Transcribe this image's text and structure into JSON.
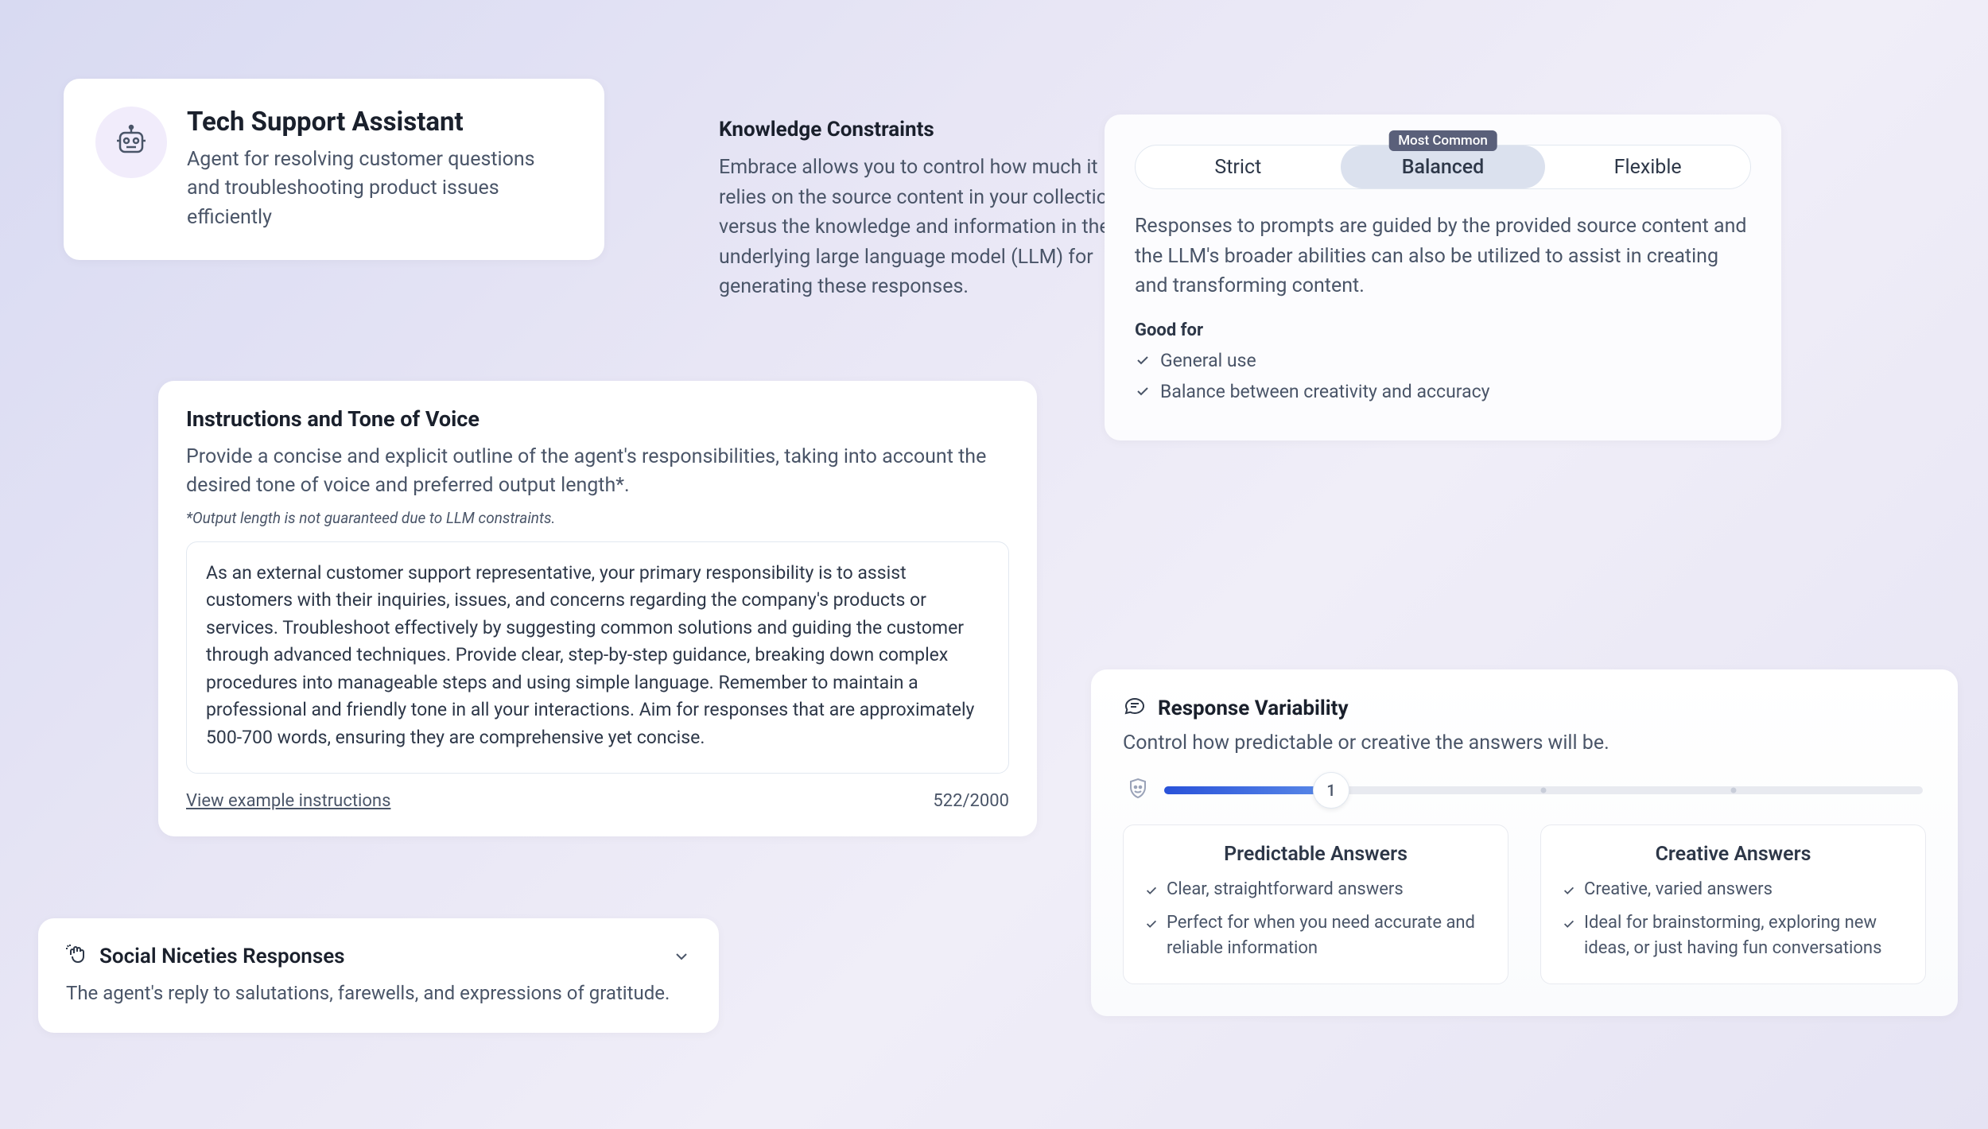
{
  "agent": {
    "title": "Tech Support Assistant",
    "description": "Agent for resolving customer questions and troubleshooting product issues efficiently"
  },
  "instructions": {
    "title": "Instructions and Tone of Voice",
    "description": "Provide a concise and explicit outline of the agent's responsibilities, taking into account the desired tone of voice and preferred output length*.",
    "footnote": "*Output length is not guaranteed due to LLM constraints.",
    "value": "As an external customer support representative, your primary responsibility is to assist customers with their inquiries, issues, and concerns regarding the company's products or services. Troubleshoot effectively by suggesting common solutions and guiding the customer through advanced techniques. Provide clear, step-by-step guidance, breaking down complex procedures into manageable steps and using simple language. Remember to maintain a professional and friendly tone in all your interactions. Aim for responses that are approximately 500-700 words, ensuring they are comprehensive yet concise.",
    "example_link": "View example instructions",
    "char_count": "522/2000"
  },
  "social": {
    "title": "Social Niceties Responses",
    "description": "The agent's reply to salutations, farewells, and expressions of gratitude."
  },
  "knowledge": {
    "title": "Knowledge Constraints",
    "description": "Embrace allows you to control how much it relies on the source content in your collections versus the knowledge and information in the underlying large language model (LLM) for generating these responses.",
    "options": {
      "strict": "Strict",
      "balanced": "Balanced",
      "flexible": "Flexible"
    },
    "badge": "Most Common",
    "selected": "balanced",
    "explanation": "Responses to prompts are guided by the provided source content and the LLM's broader abilities can also be utilized to assist in creating and transforming content.",
    "goodfor_label": "Good for",
    "goodfor": [
      "General use",
      "Balance between creativity and accuracy"
    ]
  },
  "response_variability": {
    "title": "Response Variability",
    "description": "Control how predictable or creative the answers will be.",
    "slider_value": "1",
    "predictable": {
      "title": "Predictable Answers",
      "points": [
        "Clear, straightforward answers",
        "Perfect for when you need accurate and reliable information"
      ]
    },
    "creative": {
      "title": "Creative Answers",
      "points": [
        "Creative, varied answers",
        "Ideal for brainstorming, exploring new ideas, or just having fun conversations"
      ]
    }
  }
}
